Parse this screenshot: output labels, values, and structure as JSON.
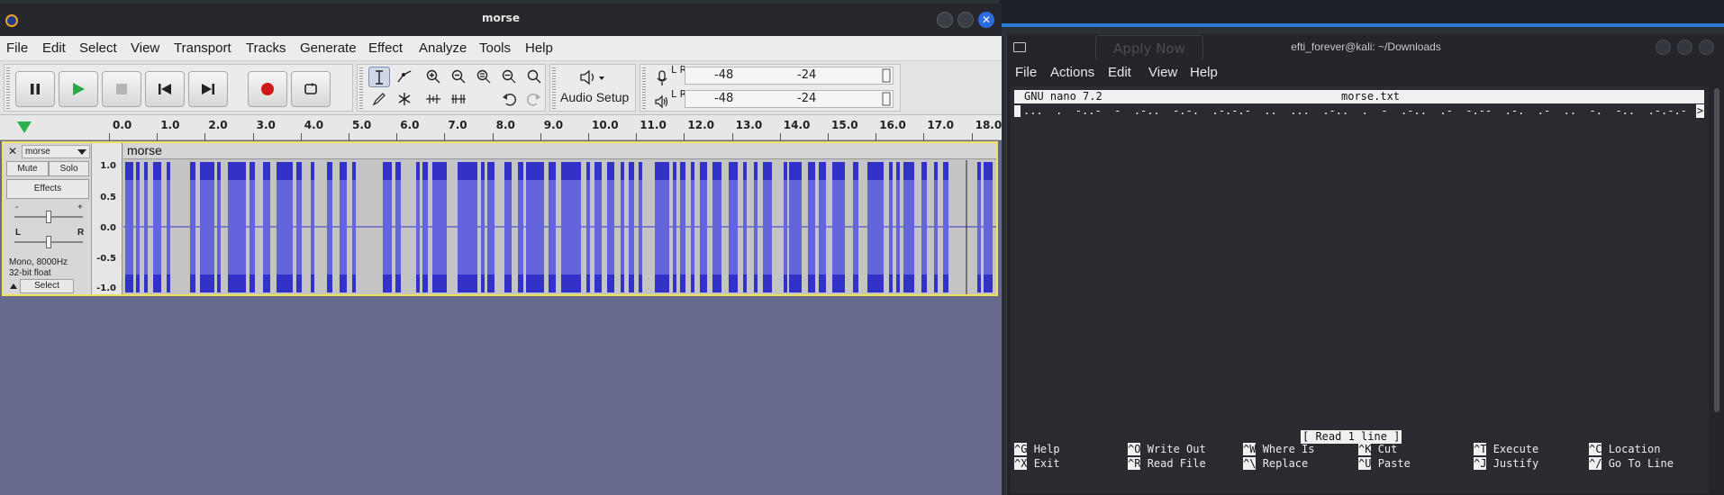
{
  "audacity": {
    "title": "morse",
    "menus": [
      "File",
      "Edit",
      "Select",
      "View",
      "Transport",
      "Tracks",
      "Generate",
      "Effect",
      "Analyze",
      "Tools",
      "Help"
    ],
    "audio_setup_label": "Audio Setup",
    "meter_record": {
      "left": "-48",
      "right": "-24"
    },
    "meter_play": {
      "left": "-48",
      "right": "-24"
    },
    "meter_lr": "L R",
    "ruler_ticks": [
      "0.0",
      "1.0",
      "2.0",
      "3.0",
      "4.0",
      "5.0",
      "6.0",
      "7.0",
      "8.0",
      "9.0",
      "10.0",
      "11.0",
      "12.0",
      "13.0",
      "14.0",
      "15.0",
      "16.0",
      "17.0",
      "18.0"
    ],
    "track": {
      "name": "morse",
      "mute_label": "Mute",
      "solo_label": "Solo",
      "effects_label": "Effects",
      "gain_minus": "-",
      "gain_plus": "+",
      "pan_left": "L",
      "pan_right": "R",
      "info_line1": "Mono, 8000Hz",
      "info_line2": "32-bit float",
      "select_label": "Select",
      "clip_name": "morse",
      "amplitude_ticks": [
        "1.0",
        "0.5",
        "0.0",
        "-0.5",
        "-1.0"
      ]
    },
    "colors": {
      "waveform": "#3232c8",
      "waveform_rms": "#6464dc",
      "selection_border": "#f1e25a",
      "record_red": "#d01818"
    }
  },
  "terminal": {
    "title": "efti_forever@kali: ~/Downloads",
    "menus": [
      "File",
      "Actions",
      "Edit",
      "View",
      "Help"
    ],
    "ghost_button": "Apply Now",
    "nano": {
      "version": "GNU nano 7.2",
      "filename": "morse.txt",
      "content_line": "...  .  -..-  -  .-..  -.-.  .-.-.-  ..  ...  .-..  .  -  .-..  .-  -.--  .-.  .-  ..  -.  -..  .-.-.-  .  .-  --  .  .-.  .-  -.--  ...",
      "more_marker": ">",
      "status": "[ Read 1 line ]",
      "shortcuts": [
        {
          "key": "^G",
          "label": "Help"
        },
        {
          "key": "^O",
          "label": "Write Out"
        },
        {
          "key": "^W",
          "label": "Where Is"
        },
        {
          "key": "^K",
          "label": "Cut"
        },
        {
          "key": "^T",
          "label": "Execute"
        },
        {
          "key": "^C",
          "label": "Location"
        },
        {
          "key": "^X",
          "label": "Exit"
        },
        {
          "key": "^R",
          "label": "Read File"
        },
        {
          "key": "^\\",
          "label": "Replace"
        },
        {
          "key": "^U",
          "label": "Paste"
        },
        {
          "key": "^J",
          "label": "Justify"
        },
        {
          "key": "^/",
          "label": "Go To Line"
        }
      ]
    }
  }
}
